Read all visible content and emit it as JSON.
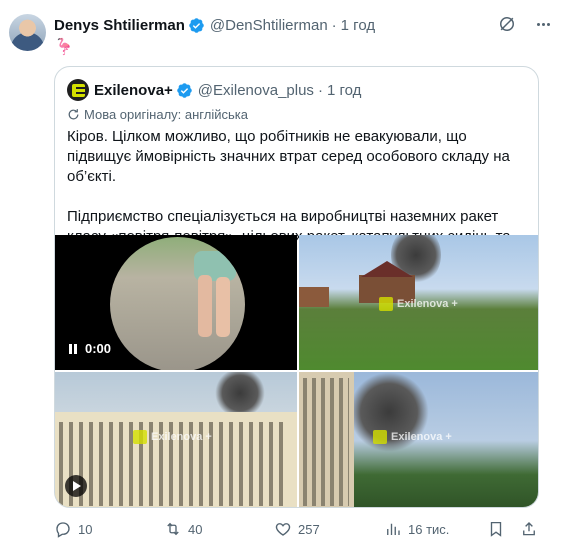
{
  "tweet": {
    "author_name": "Denys Shtilierman",
    "handle": "@DenShtilierman",
    "separator": "·",
    "time": "1 год",
    "text": "🦩"
  },
  "quote": {
    "author_name": "Exilenova+",
    "handle": "@Exilenova_plus",
    "separator": "·",
    "time": "1 год",
    "translate_label": "Мова оригіналу: англійська",
    "paragraph1": "Кіров. Цілком можливо, що робітників не евакуювали, що підвищує ймовірність значних втрат серед особового складу на об’єкті.",
    "paragraph2": "Підприємство спеціалізується на виробництві наземних ракет класу «повітря-повітря», цільових ракет, катапультних сидінь та авіаційних ...",
    "video_time": "0:00",
    "watermark": "Exilenova +"
  },
  "actions": {
    "replies": "10",
    "retweets": "40",
    "likes": "257",
    "views": "16 тис."
  },
  "colors": {
    "verified": "#1d9bf0",
    "muted": "#536471",
    "brand": "#d4e000"
  }
}
